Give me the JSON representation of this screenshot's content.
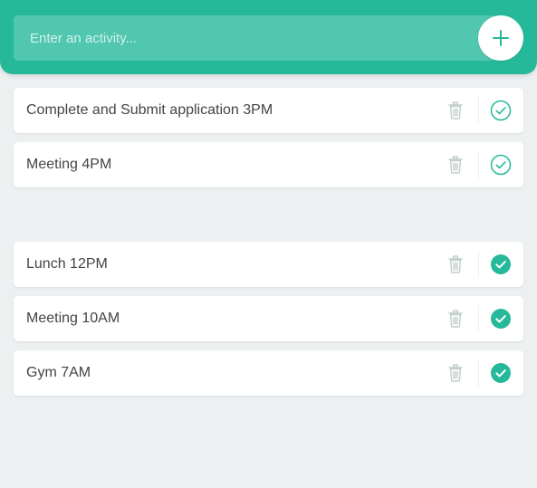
{
  "header": {
    "input_placeholder": "Enter an activity...",
    "add_icon": "plus-icon"
  },
  "todo": [
    {
      "text": "Complete and Submit application 3PM"
    },
    {
      "text": "Meeting 4PM"
    }
  ],
  "completed": [
    {
      "text": "Lunch 12PM"
    },
    {
      "text": "Meeting 10AM"
    },
    {
      "text": "Gym 7AM"
    }
  ],
  "colors": {
    "accent": "#25b99a",
    "background": "#edf0f1",
    "text": "#444444",
    "trash": "#c0cecb"
  }
}
